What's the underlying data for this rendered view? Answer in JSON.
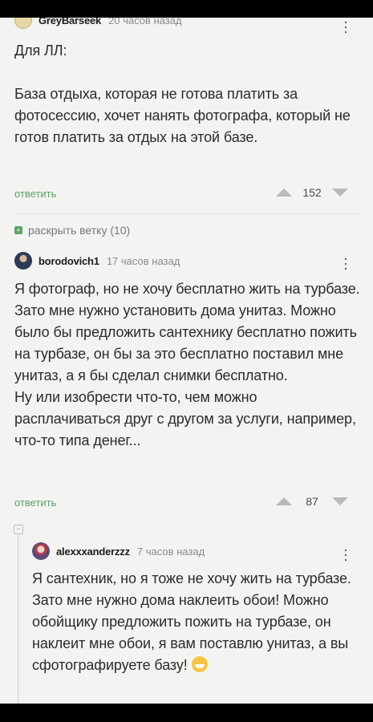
{
  "comments": [
    {
      "author": "GreyBarseek",
      "time": "20 часов назад",
      "text": "Для ЛЛ:\n\nБаза отдыха, которая не готова платить за фотосессию, хочет нанять фотографа, который не готов платить за отдых на этой базе.",
      "reply_label": "ответить",
      "score": "152"
    },
    {
      "author": "borodovich1",
      "time": "17 часов назад",
      "text": "Я фотограф, но не хочу бесплатно жить на турбазе. Зато мне нужно установить дома унитаз. Можно было бы предложить сантехнику бесплатно пожить на турбазе, он бы за это бесплатно поставил мне унитаз, а я бы сделал снимки бесплатно.\nНу или изобрести что-то, чем можно расплачиваться друг с другом за услуги, например, что-то типа денег...",
      "reply_label": "ответить",
      "score": "87"
    },
    {
      "author": "alexxxanderzzz",
      "time": "7 часов назад",
      "text": "Я сантехник, но я тоже не хочу жить на турбазе. Зато мне нужно дома наклеить обои! Можно обойщику предложить пожить на турбазе, он наклеит мне обои, я вам поставлю унитаз, а вы сфотографируете базу!"
    }
  ],
  "expand_branch": "раскрыть ветку (10)",
  "icons": {
    "more": "more-vertical-icon",
    "upvote": "arrow-up-icon",
    "downvote": "arrow-down-icon",
    "expand": "plus-icon",
    "collapse": "minus-icon",
    "emoji": "grinning-face-icon"
  },
  "colors": {
    "accent": "#5aa36a",
    "background": "#f3f3f1"
  }
}
